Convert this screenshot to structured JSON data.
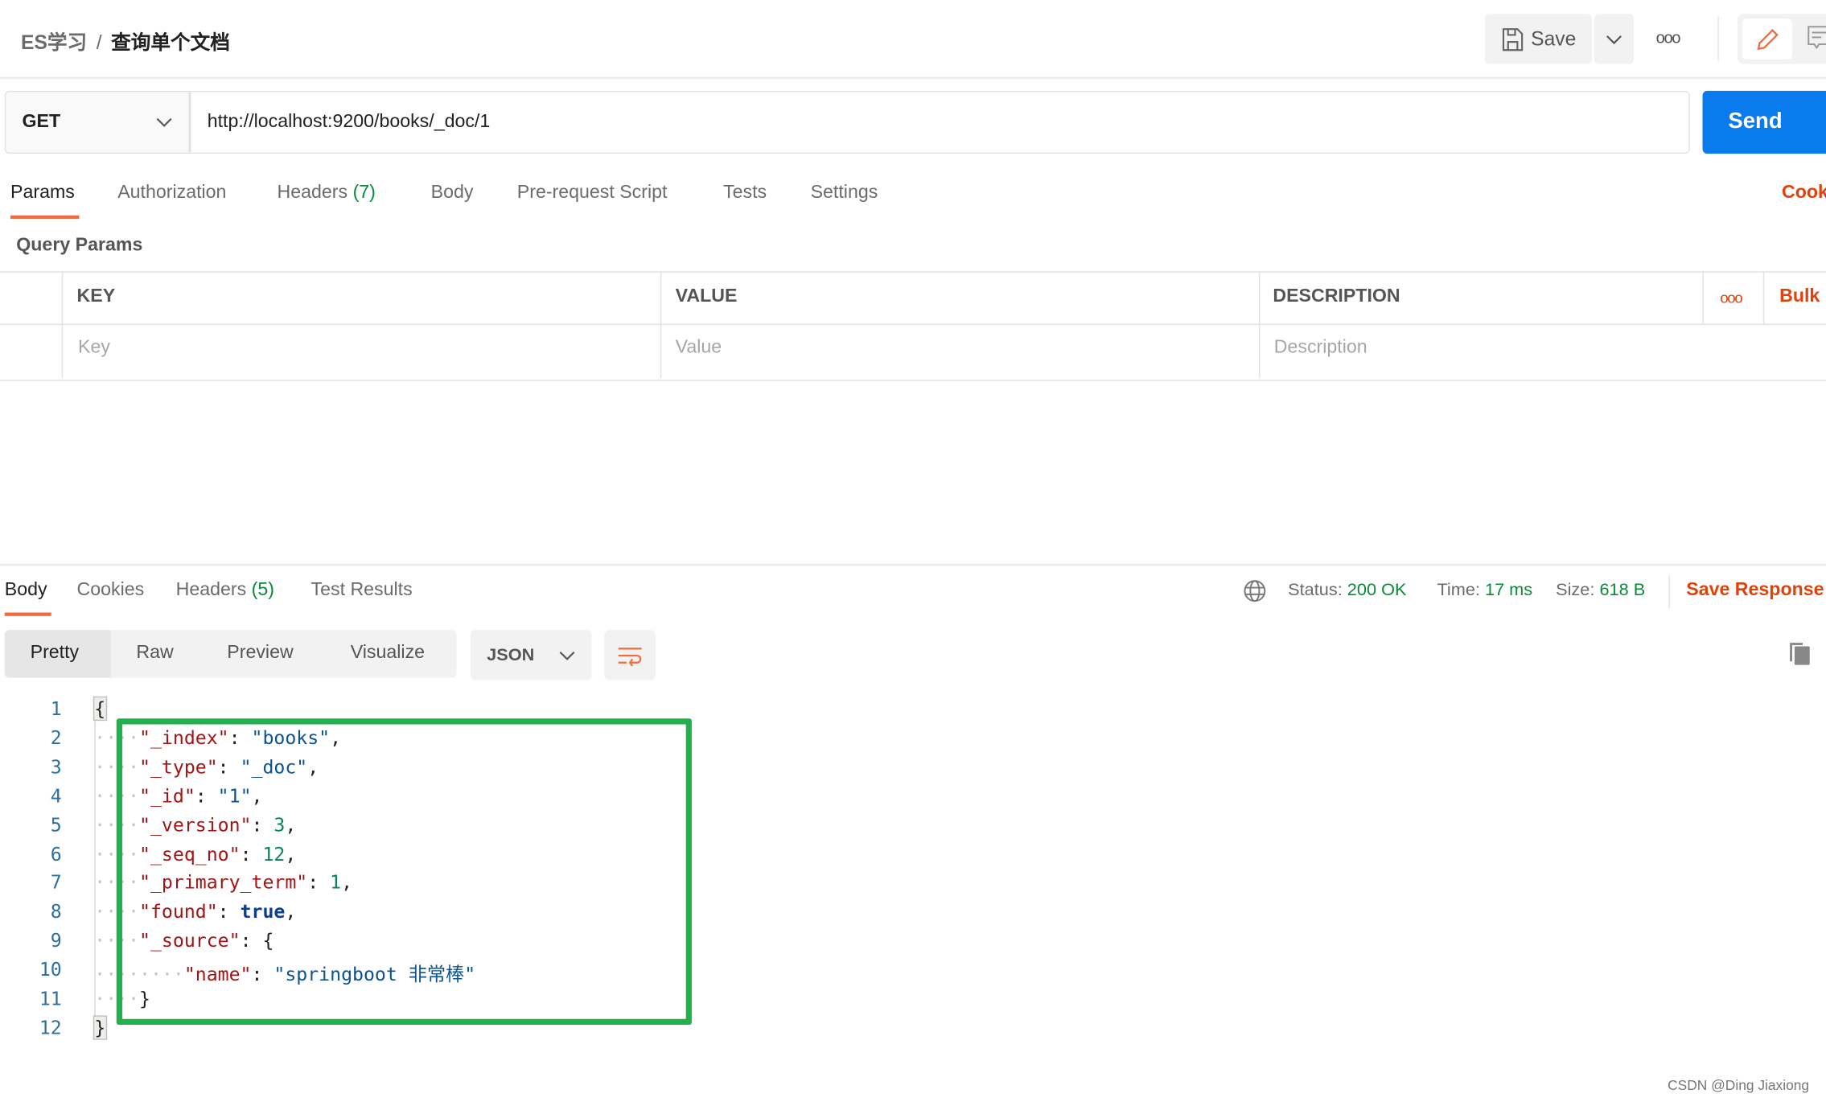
{
  "breadcrumb": {
    "parent": "ES学习",
    "separator": "/",
    "current": "查询单个文档"
  },
  "toolbar": {
    "save_label": "Save",
    "more_label": "ooo"
  },
  "request": {
    "method": "GET",
    "url": "http://localhost:9200/books/_doc/1",
    "send_label": "Send"
  },
  "request_tabs": [
    {
      "label": "Params",
      "active": true
    },
    {
      "label": "Authorization"
    },
    {
      "label": "Headers",
      "count": "(7)"
    },
    {
      "label": "Body"
    },
    {
      "label": "Pre-request Script"
    },
    {
      "label": "Tests"
    },
    {
      "label": "Settings"
    }
  ],
  "cookies_link": "Cook",
  "query_params": {
    "title": "Query Params",
    "headers": [
      "KEY",
      "VALUE",
      "DESCRIPTION"
    ],
    "placeholders": [
      "Key",
      "Value",
      "Description"
    ],
    "more_label": "ooo",
    "bulk_label": "Bulk"
  },
  "response_tabs": [
    {
      "label": "Body",
      "active": true
    },
    {
      "label": "Cookies"
    },
    {
      "label": "Headers",
      "count": "(5)"
    },
    {
      "label": "Test Results"
    }
  ],
  "response_status": {
    "status_label": "Status:",
    "status": "200 OK",
    "time_label": "Time:",
    "time": "17 ms",
    "size_label": "Size:",
    "size": "618 B",
    "save_response": "Save Response"
  },
  "view_modes": [
    "Pretty",
    "Raw",
    "Preview",
    "Visualize"
  ],
  "format": "JSON",
  "colors": {
    "accent": "#f26b3a",
    "send": "#097bed",
    "success": "#0a8a3a",
    "link": "#e0420a",
    "highlight_box": "#22b14c"
  },
  "code_lines": [
    {
      "indent": 0,
      "tokens": [
        [
          "p",
          "{"
        ]
      ]
    },
    {
      "indent": 1,
      "tokens": [
        [
          "k",
          "\"_index\""
        ],
        [
          "p",
          ": "
        ],
        [
          "s",
          "\"books\""
        ],
        [
          "p",
          ","
        ]
      ]
    },
    {
      "indent": 1,
      "tokens": [
        [
          "k",
          "\"_type\""
        ],
        [
          "p",
          ": "
        ],
        [
          "s",
          "\"_doc\""
        ],
        [
          "p",
          ","
        ]
      ]
    },
    {
      "indent": 1,
      "tokens": [
        [
          "k",
          "\"_id\""
        ],
        [
          "p",
          ": "
        ],
        [
          "s",
          "\"1\""
        ],
        [
          "p",
          ","
        ]
      ]
    },
    {
      "indent": 1,
      "tokens": [
        [
          "k",
          "\"_version\""
        ],
        [
          "p",
          ": "
        ],
        [
          "n",
          "3"
        ],
        [
          "p",
          ","
        ]
      ]
    },
    {
      "indent": 1,
      "tokens": [
        [
          "k",
          "\"_seq_no\""
        ],
        [
          "p",
          ": "
        ],
        [
          "n",
          "12"
        ],
        [
          "p",
          ","
        ]
      ]
    },
    {
      "indent": 1,
      "tokens": [
        [
          "k",
          "\"_primary_term\""
        ],
        [
          "p",
          ": "
        ],
        [
          "n",
          "1"
        ],
        [
          "p",
          ","
        ]
      ]
    },
    {
      "indent": 1,
      "tokens": [
        [
          "k",
          "\"found\""
        ],
        [
          "p",
          ": "
        ],
        [
          "b",
          "true"
        ],
        [
          "p",
          ","
        ]
      ]
    },
    {
      "indent": 1,
      "tokens": [
        [
          "k",
          "\"_source\""
        ],
        [
          "p",
          ": {"
        ]
      ]
    },
    {
      "indent": 2,
      "tokens": [
        [
          "k",
          "\"name\""
        ],
        [
          "p",
          ": "
        ],
        [
          "s",
          "\"springboot 非常棒\""
        ]
      ]
    },
    {
      "indent": 1,
      "tokens": [
        [
          "p",
          "}"
        ]
      ]
    },
    {
      "indent": 0,
      "tokens": [
        [
          "p",
          "}"
        ]
      ]
    }
  ],
  "watermark": "CSDN @Ding Jiaxiong"
}
